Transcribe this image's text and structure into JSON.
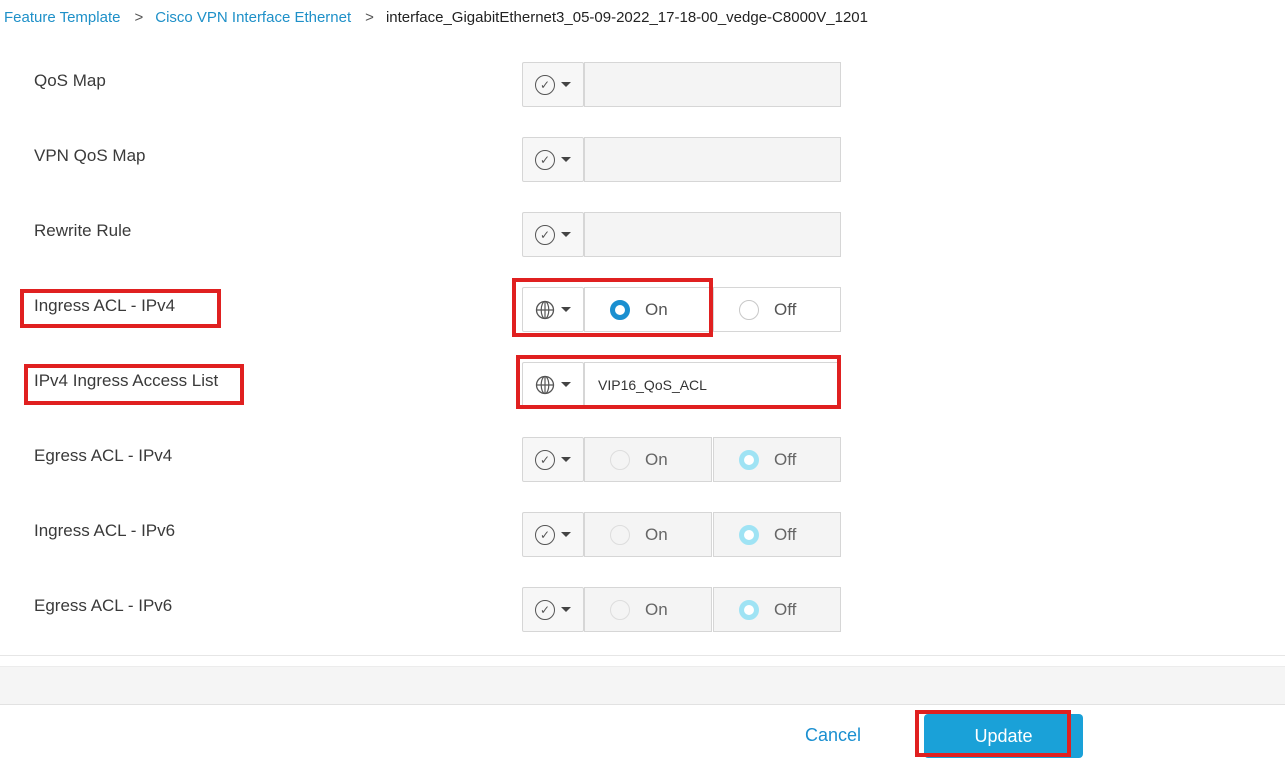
{
  "breadcrumb": {
    "item1": "Feature Template",
    "item2": "Cisco VPN Interface Ethernet",
    "current": "interface_GigabitEthernet3_05-09-2022_17-18-00_vedge-C8000V_1201"
  },
  "rows": {
    "qos_map": {
      "label": "QoS Map",
      "scope": "default",
      "value": ""
    },
    "vpn_qos_map": {
      "label": "VPN QoS Map",
      "scope": "default",
      "value": ""
    },
    "rewrite_rule": {
      "label": "Rewrite Rule",
      "scope": "default",
      "value": ""
    },
    "ingress_acl_ipv4": {
      "label": "Ingress ACL - IPv4",
      "scope": "global",
      "on_label": "On",
      "off_label": "Off",
      "selected": "On"
    },
    "ipv4_ingress_access_list": {
      "label": "IPv4 Ingress Access List",
      "scope": "global",
      "value": "VIP16_QoS_ACL"
    },
    "egress_acl_ipv4": {
      "label": "Egress ACL - IPv4",
      "scope": "default",
      "on_label": "On",
      "off_label": "Off",
      "selected": "Off"
    },
    "ingress_acl_ipv6": {
      "label": "Ingress ACL - IPv6",
      "scope": "default",
      "on_label": "On",
      "off_label": "Off",
      "selected": "Off"
    },
    "egress_acl_ipv6": {
      "label": "Egress ACL - IPv6",
      "scope": "default",
      "on_label": "On",
      "off_label": "Off",
      "selected": "Off"
    }
  },
  "icons": {
    "default_scope": "check-circle-icon",
    "global_scope": "globe-icon",
    "dropdown": "caret-down-icon",
    "check_glyph": "✓"
  },
  "footer": {
    "cancel_label": "Cancel",
    "update_label": "Update"
  },
  "colors": {
    "accent": "#1a8fd0",
    "update_button": "#1aa1d8",
    "highlight_box": "#e02020",
    "faded_radio": "#9fe3f4"
  }
}
